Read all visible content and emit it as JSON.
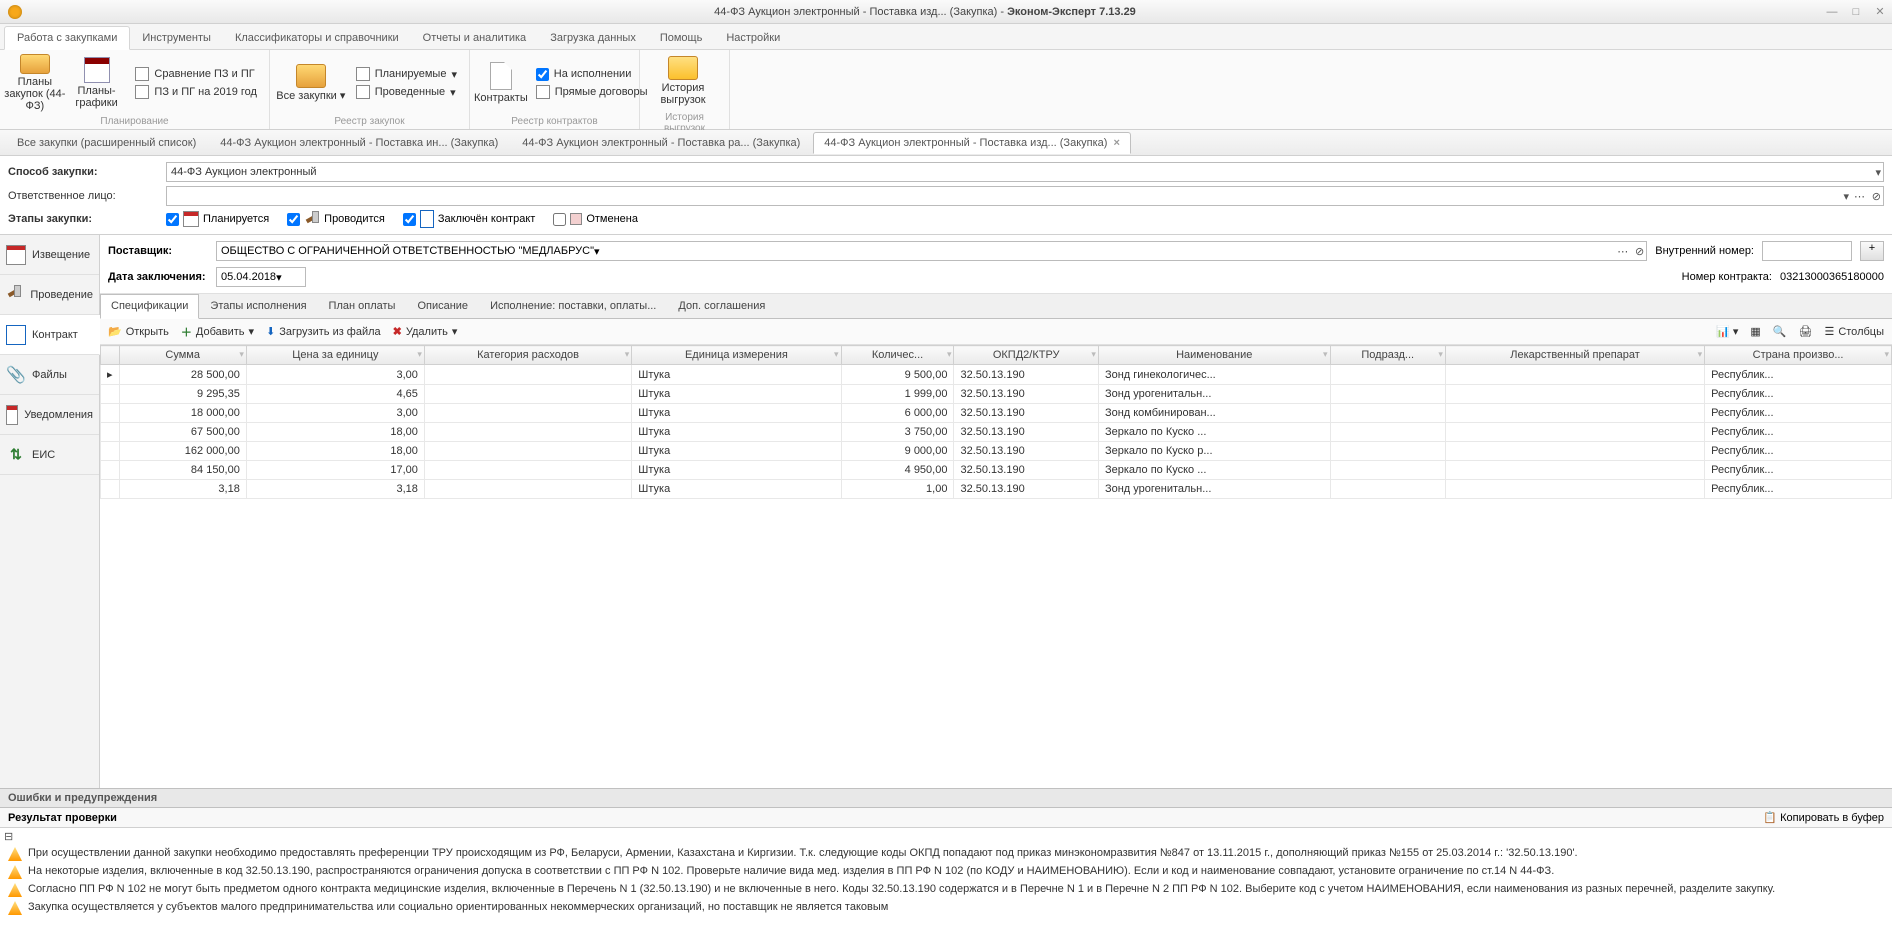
{
  "title_prefix": "44-ФЗ Аукцион электронный - Поставка изд... (Закупка) - ",
  "app_name": "Эконом-Эксперт 7.13.29",
  "menu_tabs": [
    "Работа с закупками",
    "Инструменты",
    "Классификаторы и справочники",
    "Отчеты и аналитика",
    "Загрузка данных",
    "Помощь",
    "Настройки"
  ],
  "ribbon": {
    "group1_label": "Планирование",
    "btn_plans": "Планы закупок\n(44-ФЗ)",
    "btn_plang": "Планы-графики",
    "btn_compare": "Сравнение ПЗ и ПГ",
    "btn_pzpg": "ПЗ и ПГ на 2019 год",
    "group2_label": "Реестр закупок",
    "btn_all": "Все закупки",
    "btn_planned": "Планируемые",
    "btn_done": "Проведенные",
    "group3_label": "Реестр контрактов",
    "btn_contracts": "Контракты",
    "btn_onexec": "На исполнении",
    "btn_direct": "Прямые договоры",
    "group4_label": "История выгрузок",
    "btn_history1": "История",
    "btn_history2": "выгрузок"
  },
  "doc_tabs": [
    "Все закупки (расширенный список)",
    "44-ФЗ Аукцион электронный - Поставка  ин... (Закупка)",
    "44-ФЗ Аукцион электронный - Поставка  ра... (Закупка)",
    "44-ФЗ Аукцион электронный - Поставка изд... (Закупка)"
  ],
  "form": {
    "method_label": "Способ закупки:",
    "method_value": "44-ФЗ Аукцион электронный",
    "resp_label": "Ответственное лицо:",
    "resp_value": "",
    "stages_label": "Этапы закупки:",
    "stage1": "Планируется",
    "stage2": "Проводится",
    "stage3": "Заключён контракт",
    "stage4": "Отменена"
  },
  "left_nav": {
    "notice": "Извещение",
    "conduct": "Проведение",
    "contract": "Контракт",
    "files": "Файлы",
    "notif": "Уведомления",
    "eis": "ЕИС"
  },
  "supplier": {
    "label": "Поставщик:",
    "value": "ОБЩЕСТВО С ОГРАНИЧЕННОЙ ОТВЕТСТВЕННОСТЬЮ \"МЕДЛАБРУС\"",
    "date_label": "Дата заключения:",
    "date_value": "05.04.2018",
    "inner_num_label": "Внутренний номер:",
    "inner_num_value": "",
    "contract_num_label": "Номер контракта:",
    "contract_num_value": "03213000365180000"
  },
  "inner_tabs": [
    "Спецификации",
    "Этапы исполнения",
    "План оплаты",
    "Описание",
    "Исполнение: поставки, оплаты...",
    "Доп. соглашения"
  ],
  "toolbar": {
    "open": "Открыть",
    "add": "Добавить",
    "load": "Загрузить из файла",
    "del": "Удалить",
    "cols": "Столбцы"
  },
  "columns": [
    "Сумма",
    "Цена за единицу",
    "Категория расходов",
    "Единица измерения",
    "Количес...",
    "ОКПД2/КТРУ",
    "Наименование",
    "Подразд...",
    "Лекарственный препарат",
    "Страна произво..."
  ],
  "rows": [
    {
      "sum": "28 500,00",
      "price": "3,00",
      "cat": "",
      "unit": "Штука",
      "qty": "9 500,00",
      "okpd": "32.50.13.190",
      "name": "Зонд гинекологичес...",
      "sub": "",
      "drug": "",
      "country": "Республик..."
    },
    {
      "sum": "9 295,35",
      "price": "4,65",
      "cat": "",
      "unit": "Штука",
      "qty": "1 999,00",
      "okpd": "32.50.13.190",
      "name": "Зонд урогенитальн...",
      "sub": "",
      "drug": "",
      "country": "Республик..."
    },
    {
      "sum": "18 000,00",
      "price": "3,00",
      "cat": "",
      "unit": "Штука",
      "qty": "6 000,00",
      "okpd": "32.50.13.190",
      "name": "Зонд комбинирован...",
      "sub": "",
      "drug": "",
      "country": "Республик..."
    },
    {
      "sum": "67 500,00",
      "price": "18,00",
      "cat": "",
      "unit": "Штука",
      "qty": "3 750,00",
      "okpd": "32.50.13.190",
      "name": "Зеркало  по Куско ...",
      "sub": "",
      "drug": "",
      "country": "Республик..."
    },
    {
      "sum": "162 000,00",
      "price": "18,00",
      "cat": "",
      "unit": "Штука",
      "qty": "9 000,00",
      "okpd": "32.50.13.190",
      "name": "Зеркало  по Куско р...",
      "sub": "",
      "drug": "",
      "country": "Республик..."
    },
    {
      "sum": "84 150,00",
      "price": "17,00",
      "cat": "",
      "unit": "Штука",
      "qty": "4 950,00",
      "okpd": "32.50.13.190",
      "name": "Зеркало  по Куско ...",
      "sub": "",
      "drug": "",
      "country": "Республик..."
    },
    {
      "sum": "3,18",
      "price": "3,18",
      "cat": "",
      "unit": "Штука",
      "qty": "1,00",
      "okpd": "32.50.13.190",
      "name": "Зонд урогенитальн...",
      "sub": "",
      "drug": "",
      "country": "Республик..."
    }
  ],
  "errors_header": "Ошибки и предупреждения",
  "result_label": "Результат проверки",
  "copy_buf": "Копировать в буфер",
  "warnings": [
    "При осуществлении данной закупки необходимо предоставлять преференции ТРУ происходящим из РФ, Беларуси, Армении, Казахстана и Киргизии. Т.к. следующие коды ОКПД попадают под приказ минэкономразвития №847 от 13.11.2015 г., дополняющий приказ №155 от 25.03.2014 г.: '32.50.13.190'.",
    "На некоторые изделия, включенные в код 32.50.13.190, распространяются ограничения допуска в соответствии с ПП РФ N 102. Проверьте наличие вида мед. изделия в ПП РФ N 102 (по КОДУ и НАИМЕНОВАНИЮ). Если и код и наименование совпадают, установите ограничение по ст.14 N 44-ФЗ.",
    "Согласно ПП РФ N 102 не могут быть предметом одного контракта медицинские изделия, включенные в Перечень N 1 (32.50.13.190) и не включенные в него. Коды 32.50.13.190 содержатся и в Перечне N 1 и в Перечне N 2 ПП РФ N 102. Выберите код с учетом НАИМЕНОВАНИЯ, если наименования из разных перечней, разделите закупку.",
    "Закупка осуществляется у субъектов малого предпринимательства или социально ориентированных некоммерческих организаций, но поставщик не является таковым"
  ]
}
